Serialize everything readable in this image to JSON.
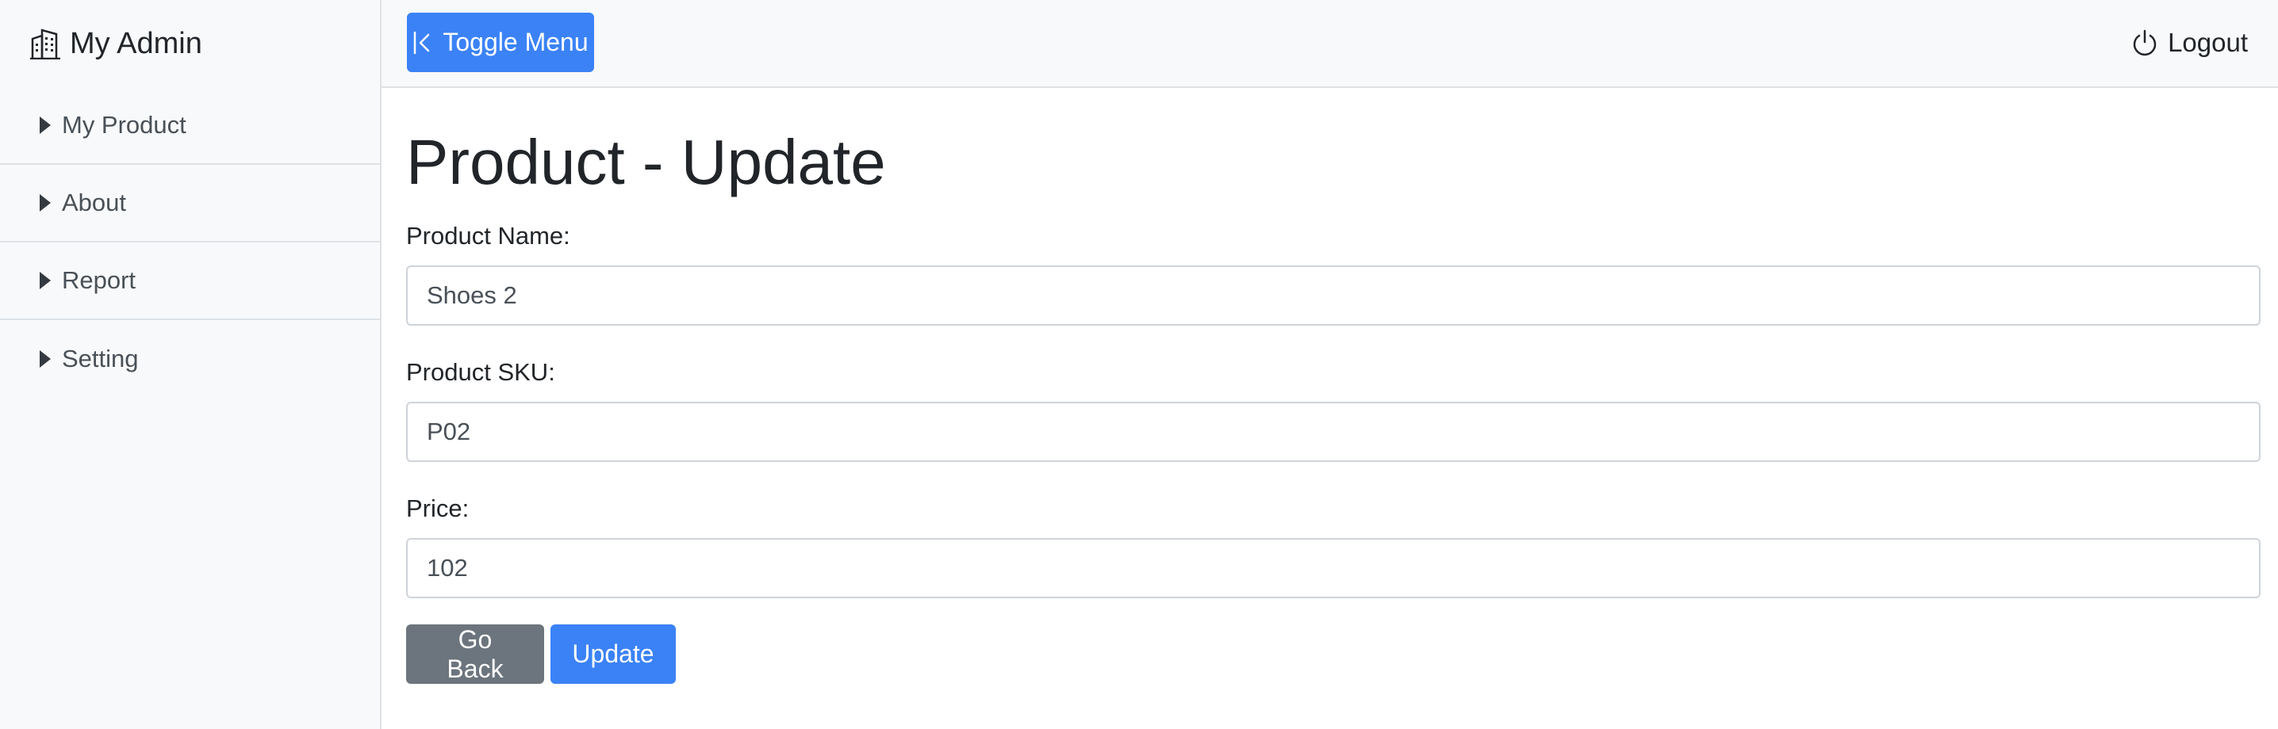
{
  "sidebar": {
    "brand": {
      "icon": "building-icon",
      "title": "My Admin"
    },
    "items": [
      {
        "label": "My Product",
        "icon": "caret-right-icon"
      },
      {
        "label": "About",
        "icon": "caret-right-icon"
      },
      {
        "label": "Report",
        "icon": "caret-right-icon"
      },
      {
        "label": "Setting",
        "icon": "caret-right-icon"
      }
    ]
  },
  "topbar": {
    "toggle_label": "Toggle Menu",
    "toggle_icon": "collapse-left-icon",
    "logout_label": "Logout",
    "logout_icon": "power-icon"
  },
  "main": {
    "title": "Product - Update",
    "fields": [
      {
        "label": "Product Name:",
        "value": "Shoes 2"
      },
      {
        "label": "Product SKU:",
        "value": "P02"
      },
      {
        "label": "Price:",
        "value": "102"
      }
    ],
    "buttons": {
      "back_label": "Go Back",
      "update_label": "Update"
    }
  },
  "colors": {
    "primary": "#3b82f6",
    "secondary": "#6c757d",
    "sidebar_bg": "#f8f9fa",
    "border": "#dee2e6",
    "text": "#212529"
  }
}
